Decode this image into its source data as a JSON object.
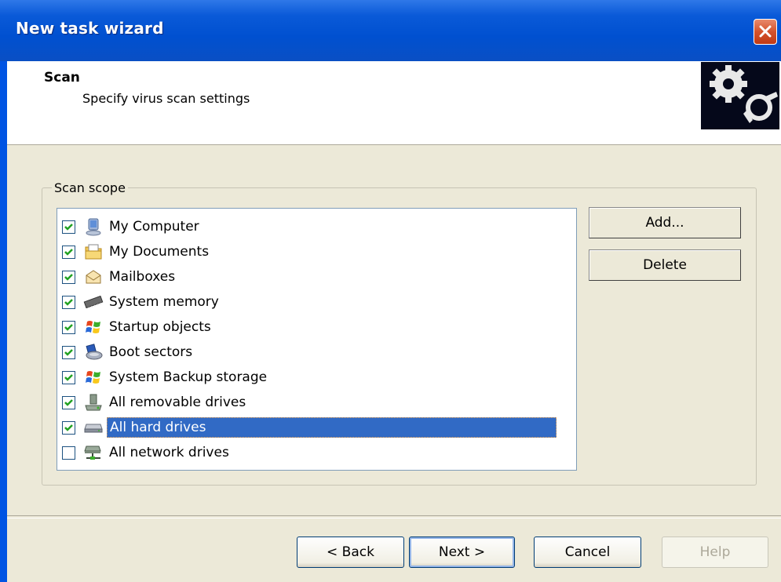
{
  "window": {
    "title": "New task wizard"
  },
  "header": {
    "title": "Scan",
    "subtitle": "Specify virus scan settings",
    "icon": "gears-icon"
  },
  "group": {
    "label": "Scan scope"
  },
  "scope_items": [
    {
      "label": "My Computer",
      "checked": true,
      "icon": "computer-icon"
    },
    {
      "label": "My Documents",
      "checked": true,
      "icon": "documents-folder-icon"
    },
    {
      "label": "Mailboxes",
      "checked": true,
      "icon": "envelope-icon"
    },
    {
      "label": "System memory",
      "checked": true,
      "icon": "memory-chip-icon"
    },
    {
      "label": "Startup objects",
      "checked": true,
      "icon": "windows-flag-icon"
    },
    {
      "label": "Boot sectors",
      "checked": true,
      "icon": "boot-sector-icon"
    },
    {
      "label": "System Backup storage",
      "checked": true,
      "icon": "windows-flag-icon"
    },
    {
      "label": "All removable drives",
      "checked": true,
      "icon": "removable-drive-icon"
    },
    {
      "label": "All hard drives",
      "checked": true,
      "icon": "hard-drive-icon",
      "selected": true
    },
    {
      "label": "All network drives",
      "checked": false,
      "icon": "network-drive-icon"
    }
  ],
  "side_buttons": {
    "add": "Add...",
    "delete": "Delete"
  },
  "footer": {
    "back": "< Back",
    "next": "Next >",
    "cancel": "Cancel",
    "help": "Help"
  },
  "colors": {
    "titlebar": "#0a5ad8",
    "selection": "#316ac5",
    "dialog": "#ece9d8",
    "check": "#21a121"
  }
}
